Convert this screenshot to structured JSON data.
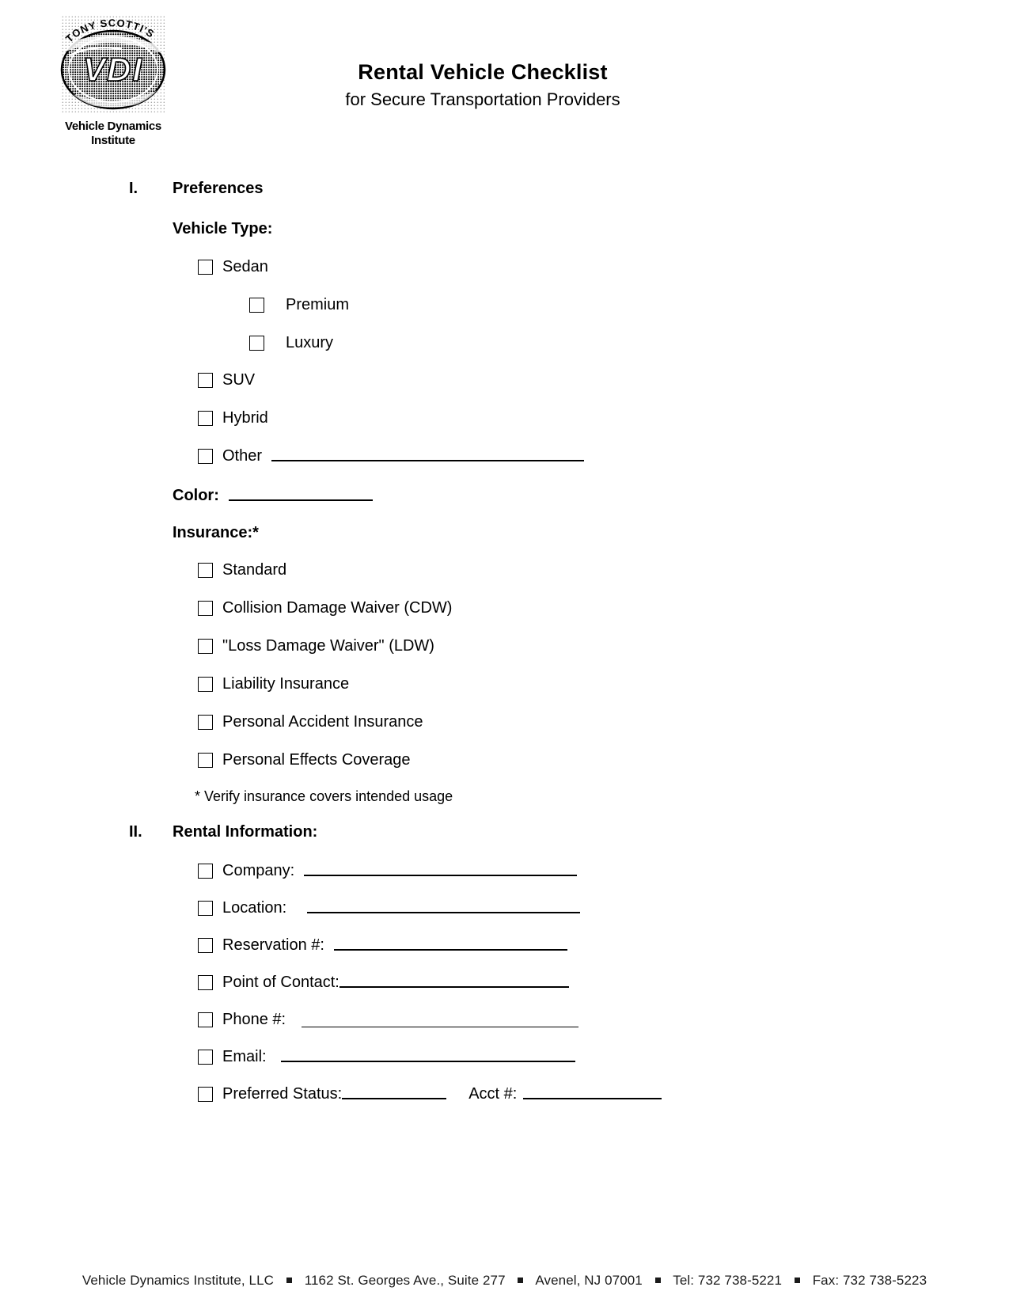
{
  "header": {
    "logo": {
      "top_arc_text": "TONY SCOTTI'S",
      "monogram": "VDI",
      "name_line1": "Vehicle Dynamics",
      "name_line2": "Institute"
    },
    "title": "Rental Vehicle Checklist",
    "subtitle": "for Secure Transportation Providers"
  },
  "sections": [
    {
      "numeral": "I.",
      "title": "Preferences",
      "vehicle_type": {
        "heading": "Vehicle Type:",
        "options": [
          {
            "label": "Sedan",
            "indent": 1,
            "line": false
          },
          {
            "label": "Premium",
            "indent": 2,
            "line": false
          },
          {
            "label": "Luxury",
            "indent": 2,
            "line": false
          },
          {
            "label": "SUV",
            "indent": 1,
            "line": false
          },
          {
            "label": "Hybrid",
            "indent": 1,
            "line": false
          },
          {
            "label": "Other",
            "indent": 1,
            "line": true
          }
        ]
      },
      "color": {
        "label": "Color:"
      },
      "insurance": {
        "heading": "Insurance:*",
        "options": [
          {
            "label": "Standard"
          },
          {
            "label": "Collision Damage Waiver (CDW)"
          },
          {
            "label": "\"Loss Damage Waiver\" (LDW)"
          },
          {
            "label": "Liability Insurance"
          },
          {
            "label": "Personal Accident Insurance"
          },
          {
            "label": "Personal Effects Coverage"
          }
        ],
        "footnote": "* Verify insurance covers intended usage"
      }
    },
    {
      "numeral": "II.",
      "title": "Rental Information:",
      "fields": [
        {
          "label": "Company:"
        },
        {
          "label": "Location:"
        },
        {
          "label": "Reservation #:"
        },
        {
          "label": "Point of Contact:"
        },
        {
          "label": "Phone #:"
        },
        {
          "label": "Email:"
        }
      ],
      "status_row": {
        "label": "Preferred Status:",
        "second_label": "Acct #:"
      }
    }
  ],
  "footer": {
    "company": "Vehicle Dynamics Institute, LLC",
    "address": "1162 St. Georges Ave., Suite 277",
    "city_state_zip": "Avenel, NJ 07001",
    "tel": "Tel:  732 738-5221",
    "fax": "Fax: 732 738-5223"
  }
}
